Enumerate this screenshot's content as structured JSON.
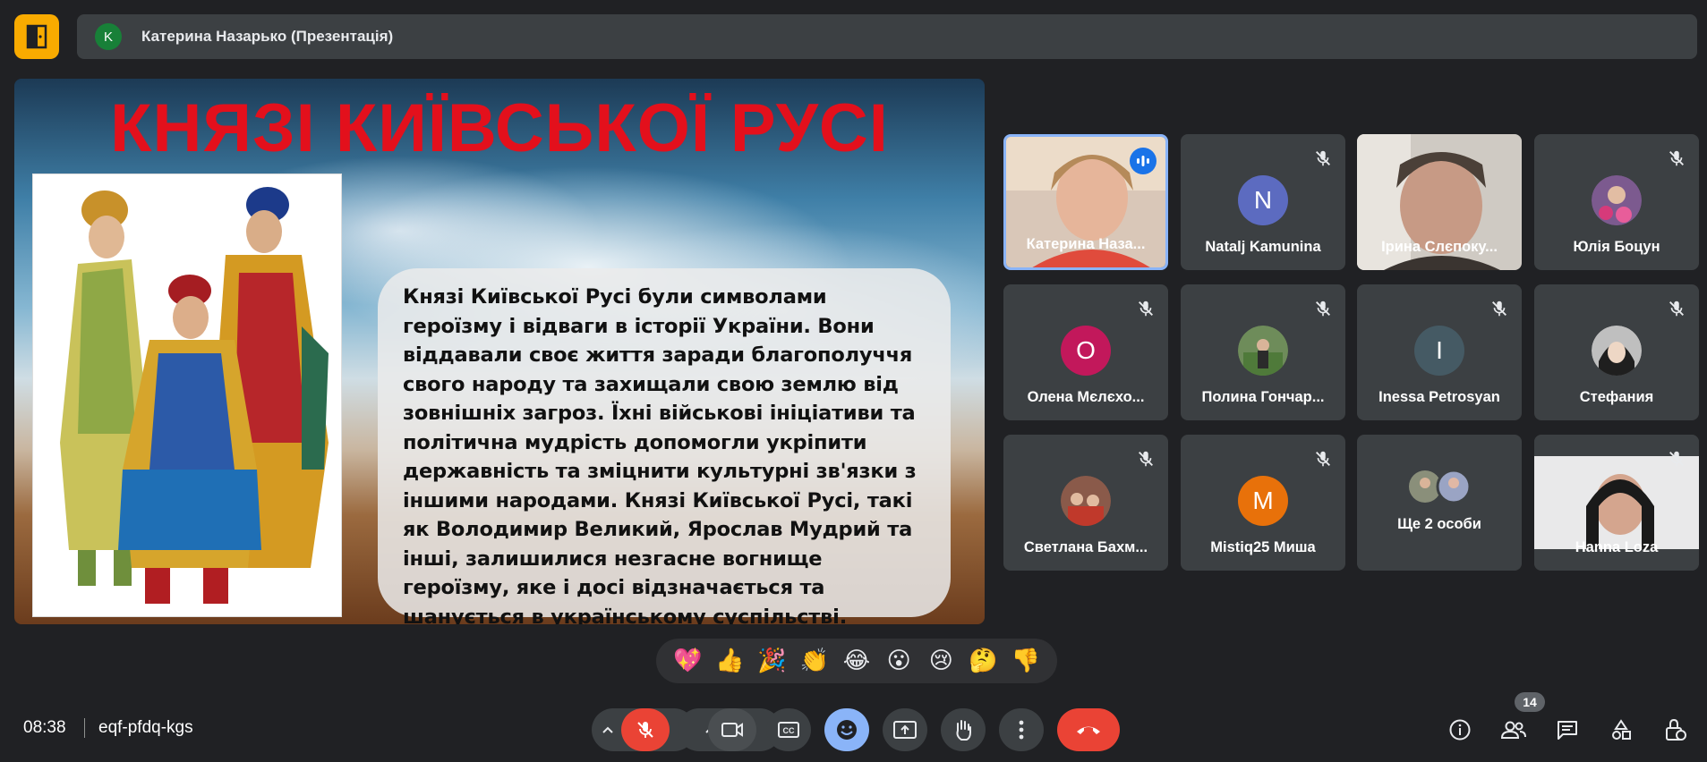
{
  "presenter": {
    "avatar_letter": "K",
    "name": "Катерина Назарько (Презентація)"
  },
  "slide": {
    "title": "КНЯЗІ КИЇВСЬКОЇ РУСІ",
    "body": "Князі Київської Русі були символами героїзму і відваги в історії України. Вони віддавали своє життя заради благополуччя свого народу та захищали свою землю від зовнішніх загроз. Їхні військові ініціативи та політична мудрість допомогли укріпити державність та зміцнити культурні зв'язки з іншими народами. Князі Київської Русі, такі як Володимир Великий, Ярослав Мудрий та інші, залишилися незгасне вогнище героїзму, яке і досі відзначається та шанується в українському суспільстві."
  },
  "participants": [
    {
      "name": "Катерина Наза...",
      "letter": "",
      "type": "video",
      "speaking": true
    },
    {
      "name": "Natalj Kamunina",
      "letter": "N",
      "type": "letter",
      "color": "#5c6bc0",
      "muted": true
    },
    {
      "name": "Ірина Слєпоку...",
      "letter": "",
      "type": "video",
      "muted": false
    },
    {
      "name": "Юлія Боцун",
      "letter": "",
      "type": "photo",
      "muted": true
    },
    {
      "name": "Олена Мєлєхо...",
      "letter": "O",
      "type": "letter",
      "color": "#c2185b",
      "muted": true
    },
    {
      "name": "Полина Гончар...",
      "letter": "",
      "type": "photo",
      "muted": true
    },
    {
      "name": "Inessa Petrosyan",
      "letter": "I",
      "type": "letter",
      "color": "#455a64",
      "muted": true
    },
    {
      "name": "Стефания",
      "letter": "",
      "type": "photo",
      "muted": true
    },
    {
      "name": "Светлана Бахм...",
      "letter": "",
      "type": "photo",
      "muted": true
    },
    {
      "name": "Mistiq25 Миша",
      "letter": "M",
      "type": "letter",
      "color": "#e8710a",
      "muted": true
    },
    {
      "name": "Ще 2 особи",
      "letter": "",
      "type": "group"
    },
    {
      "name": "Hanna Loza",
      "letter": "",
      "type": "video",
      "muted": true
    }
  ],
  "reactions": [
    "💖",
    "👍",
    "🎉",
    "👏",
    "😂",
    "😮",
    "😢",
    "🤔",
    "👎"
  ],
  "bottom": {
    "time": "08:38",
    "meeting_code": "eqf-pfdq-kgs",
    "participant_count": "14"
  },
  "colors": {
    "background": "#202124",
    "tile": "#3c4043",
    "end_call": "#ea4335",
    "active_border": "#8ab4f8",
    "title_red": "#e3101c"
  }
}
